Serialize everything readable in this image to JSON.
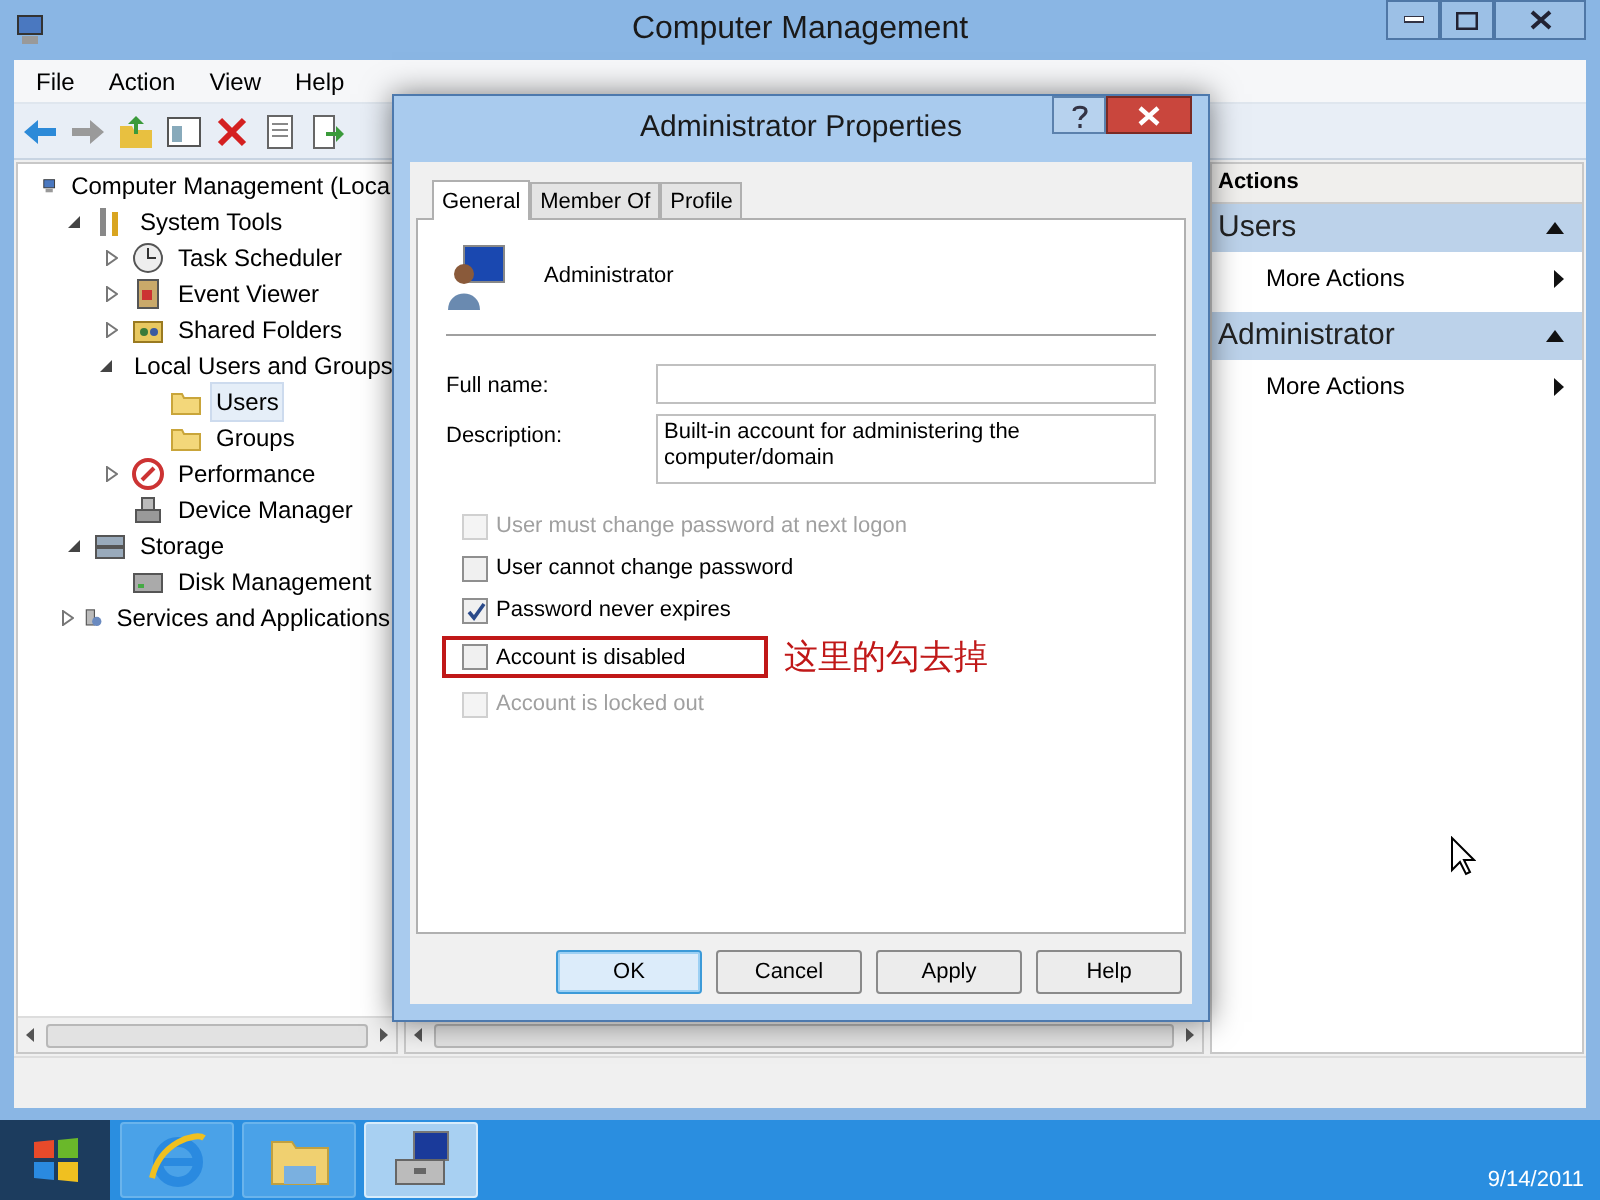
{
  "window": {
    "title": "Computer Management"
  },
  "menu": [
    "File",
    "Action",
    "View",
    "Help"
  ],
  "toolbar": [
    {
      "kind": "back",
      "disabled": false
    },
    {
      "kind": "forward",
      "disabled": true
    },
    {
      "kind": "up",
      "disabled": false
    },
    {
      "kind": "panel",
      "disabled": false
    },
    {
      "kind": "delete",
      "disabled": false
    },
    {
      "kind": "properties",
      "disabled": false
    },
    {
      "kind": "export",
      "disabled": false
    }
  ],
  "tree": [
    {
      "label": "Computer Management (Loca",
      "kind": "computer",
      "selected": false,
      "children": [
        {
          "label": "System Tools",
          "kind": "tools",
          "expanded": true,
          "selected": false,
          "children": [
            {
              "label": "Task Scheduler",
              "kind": "clock",
              "expanded": false,
              "selected": false
            },
            {
              "label": "Event Viewer",
              "kind": "log",
              "expanded": false,
              "selected": false
            },
            {
              "label": "Shared Folders",
              "kind": "share",
              "expanded": false,
              "selected": false
            },
            {
              "label": "Local Users and Groups",
              "kind": "users",
              "expanded": true,
              "selected": false,
              "children": [
                {
                  "label": "Users",
                  "kind": "folder",
                  "selected": true
                },
                {
                  "label": "Groups",
                  "kind": "folder",
                  "selected": false
                }
              ]
            },
            {
              "label": "Performance",
              "kind": "perf",
              "expanded": false,
              "selected": false
            },
            {
              "label": "Device Manager",
              "kind": "device",
              "selected": false
            }
          ]
        },
        {
          "label": "Storage",
          "kind": "storage",
          "expanded": true,
          "selected": false,
          "children": [
            {
              "label": "Disk Management",
              "kind": "disk",
              "selected": false
            }
          ]
        },
        {
          "label": "Services and Applications",
          "kind": "services",
          "expanded": false,
          "selected": false
        }
      ]
    }
  ],
  "actions": {
    "title": "Actions",
    "sections": [
      {
        "title": "Users",
        "expanded": true,
        "items": [
          {
            "label": "More Actions",
            "submenu": true
          }
        ]
      },
      {
        "title": "Administrator",
        "expanded": true,
        "items": [
          {
            "label": "More Actions",
            "submenu": true
          }
        ]
      }
    ]
  },
  "dialog": {
    "title": "Administrator Properties",
    "tabs": [
      {
        "label": "General",
        "selected": true
      },
      {
        "label": "Member Of",
        "selected": false
      },
      {
        "label": "Profile",
        "selected": false
      }
    ],
    "user_name": "Administrator",
    "fields": [
      {
        "label": "Full name:"
      },
      {
        "label": "Description:",
        "value": "Built-in account for administering the computer/domain"
      }
    ],
    "checkboxes": [
      {
        "label": "User must change password at next logon",
        "checked": false,
        "disabled": true,
        "highlighted": false
      },
      {
        "label": "User cannot change password",
        "checked": false,
        "disabled": false,
        "highlighted": false
      },
      {
        "label": "Password never expires",
        "checked": true,
        "disabled": false,
        "highlighted": false
      },
      {
        "label": "Account is disabled",
        "checked": false,
        "disabled": false,
        "highlighted": true
      },
      {
        "label": "Account is locked out",
        "checked": false,
        "disabled": true,
        "highlighted": false
      }
    ],
    "annotation": "这里的勾去掉",
    "buttons": [
      {
        "label": "OK",
        "default": true
      },
      {
        "label": "Cancel",
        "default": false
      },
      {
        "label": "Apply",
        "default": false
      },
      {
        "label": "Help",
        "default": false
      }
    ]
  },
  "taskbar": {
    "apps": [
      {
        "kind": "browser",
        "selected": false
      },
      {
        "kind": "explorer",
        "selected": false
      },
      {
        "kind": "management",
        "selected": true
      }
    ],
    "date": "9/14/2011"
  }
}
